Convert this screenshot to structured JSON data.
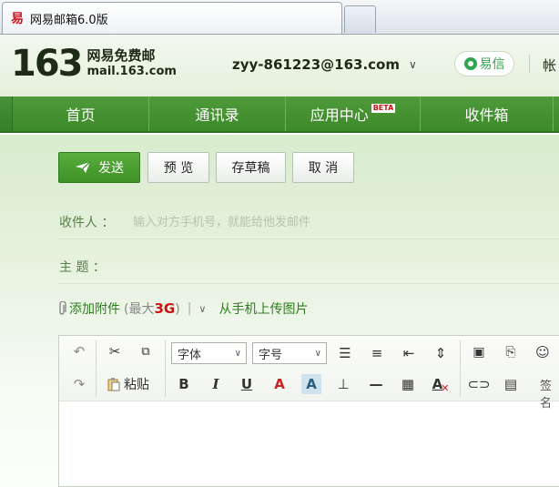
{
  "browser": {
    "tab_title": "网易邮箱6.0版",
    "favicon_glyph": "易"
  },
  "header": {
    "logo_number": "163",
    "logo_cn": "网易免费邮",
    "logo_domain": "mail.163.com",
    "account_email": "zyy-861223@163.com",
    "yixin_label": "易信",
    "account_extra": "帐"
  },
  "nav": {
    "items": [
      {
        "label": "首页"
      },
      {
        "label": "通讯录"
      },
      {
        "label": "应用中心",
        "badge": "BETA"
      },
      {
        "label": "收件箱"
      }
    ]
  },
  "compose": {
    "send_label": "发送",
    "preview_label": "预 览",
    "draft_label": "存草稿",
    "cancel_label": "取 消",
    "recipient_label": "收件人 ：",
    "recipient_placeholder": "输入对方手机号，就能给他发邮件",
    "subject_label": "主  题 ：",
    "attach_label": "添加附件",
    "attach_max_prefix": "(最大",
    "attach_max_value": "3G",
    "attach_max_suffix": ")",
    "attach_sep": "|",
    "phone_upload_label": "从手机上传图片"
  },
  "editor": {
    "font_select": "字体",
    "size_select": "字号",
    "paste_label": "粘贴",
    "sign_label": "签名"
  },
  "colors": {
    "nav_green": "#3d8a2b",
    "send_green": "#3d9126",
    "link_green": "#2e7d1f",
    "accent_red": "#cc1111"
  }
}
